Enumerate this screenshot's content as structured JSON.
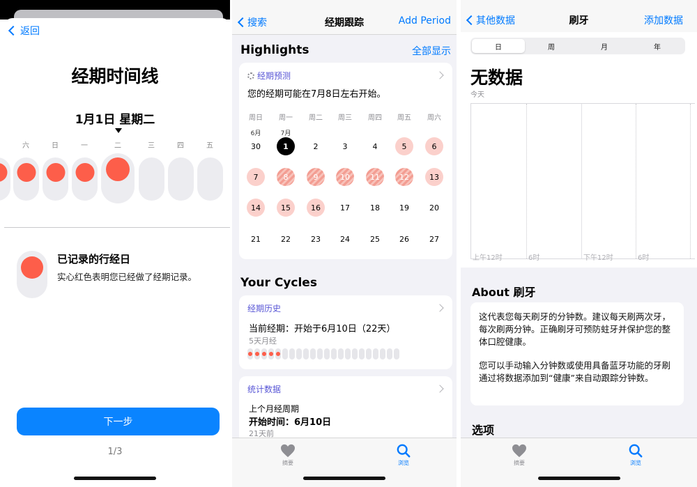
{
  "screen1": {
    "back_label": "返回",
    "title": "经期时间线",
    "date_label": "1月1日 星期二",
    "weekdays": [
      "六",
      "日",
      "一",
      "二",
      "三",
      "四",
      "五"
    ],
    "legend": {
      "title": "已记录的行经日",
      "description": "实心红色表明您已经做了经期记录。"
    },
    "next_button": "下一步",
    "pager": "1/3"
  },
  "screen2": {
    "nav": {
      "back": "搜索",
      "title": "经期跟踪",
      "action": "Add Period"
    },
    "highlights": {
      "heading": "Highlights",
      "show_all": "全部显示",
      "card_title": "经期预测",
      "prediction": "您的经期可能在7月8日左右开始。",
      "weekday_headers": [
        "周日",
        "周一",
        "周二",
        "周三",
        "周四",
        "周五",
        "周六"
      ],
      "month_labels": [
        "6月",
        "7月"
      ],
      "row1": [
        "30",
        "1",
        "2",
        "3",
        "4",
        "5",
        "6"
      ],
      "row2": [
        "7",
        "8",
        "9",
        "10",
        "11",
        "12",
        "13"
      ],
      "row3": [
        "14",
        "15",
        "16",
        "17",
        "18",
        "19",
        "20"
      ],
      "row4": [
        "21",
        "22",
        "23",
        "24",
        "25",
        "26",
        "27"
      ]
    },
    "cycles": {
      "heading": "Your Cycles",
      "history_title": "经期历史",
      "current": "当前经期：开始于6月10日（22天）",
      "flow_days": "5天月经",
      "stats_title": "统计数据",
      "last_cycle": "上个月经周期",
      "start_time": "开始时间：6月10日",
      "ago": "21天前"
    },
    "tabs": {
      "summary": "摘要",
      "browse": "浏览"
    }
  },
  "screen3": {
    "nav": {
      "back": "其他数据",
      "title": "刷牙",
      "action": "添加数据"
    },
    "segments": [
      "日",
      "周",
      "月",
      "年"
    ],
    "no_data": "无数据",
    "today": "今天",
    "x_ticks": [
      "上午12时",
      "6时",
      "下午12时",
      "6时"
    ],
    "about_heading": "About 刷牙",
    "about_p1": "这代表您每天刷牙的分钟数。建议每天刷两次牙，每次刷两分钟。正确刷牙可预防蛀牙并保护您的整体口腔健康。",
    "about_p2": "您可以手动输入分钟数或使用具备蓝牙功能的牙刷通过将数据添加到“健康”来自动跟踪分钟数。",
    "options_heading": "选项",
    "tabs": {
      "summary": "摘要",
      "browse": "浏览"
    }
  },
  "colors": {
    "accent": "#007aff",
    "period_red": "#fd5e4a",
    "predicted_pink": "#fbd0cb",
    "purple_header": "#5856d6"
  }
}
